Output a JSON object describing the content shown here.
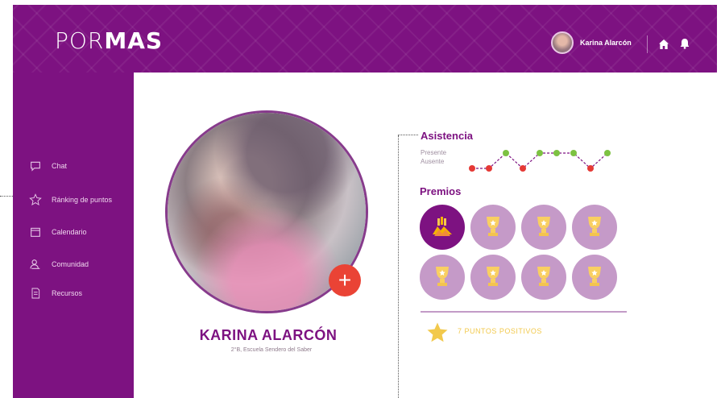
{
  "header": {
    "logo_part1": "POR",
    "logo_part2": "MAS",
    "user_name": "Karina Alarcón"
  },
  "sidebar": {
    "items": [
      {
        "label": "Chat",
        "icon": "chat-icon"
      },
      {
        "label": "Ránking de puntos",
        "icon": "star-icon"
      },
      {
        "label": "Calendario",
        "icon": "calendar-icon"
      },
      {
        "label": "Comunidad",
        "icon": "community-icon"
      },
      {
        "label": "Recursos",
        "icon": "resources-icon"
      }
    ]
  },
  "profile": {
    "name": "KARINA ALARCÓN",
    "school": "2°B, Escuela Sendero del Saber",
    "add_label": "+"
  },
  "attendance": {
    "title": "Asistencia",
    "legend_present": "Presente",
    "legend_absent": "Ausente",
    "values": [
      "absent",
      "absent",
      "present",
      "absent",
      "present",
      "present",
      "present",
      "absent",
      "present"
    ],
    "colors": {
      "present": "#7dc242",
      "absent": "#e53935"
    }
  },
  "awards": {
    "title": "Premios",
    "items": [
      {
        "state": "earned",
        "icon": "hands-icon"
      },
      {
        "state": "locked",
        "icon": "trophy-icon"
      },
      {
        "state": "locked",
        "icon": "trophy-icon"
      },
      {
        "state": "locked",
        "icon": "trophy-icon"
      },
      {
        "state": "locked",
        "icon": "trophy-icon"
      },
      {
        "state": "locked",
        "icon": "trophy-icon"
      },
      {
        "state": "locked",
        "icon": "trophy-icon"
      },
      {
        "state": "locked",
        "icon": "trophy-icon"
      }
    ]
  },
  "points": {
    "label": "7 PUNTOS POSITIVOS"
  },
  "colors": {
    "brand": "#7d1281",
    "badge": "#c59ac8",
    "accent": "#ea4335",
    "star": "#f2c94c"
  }
}
